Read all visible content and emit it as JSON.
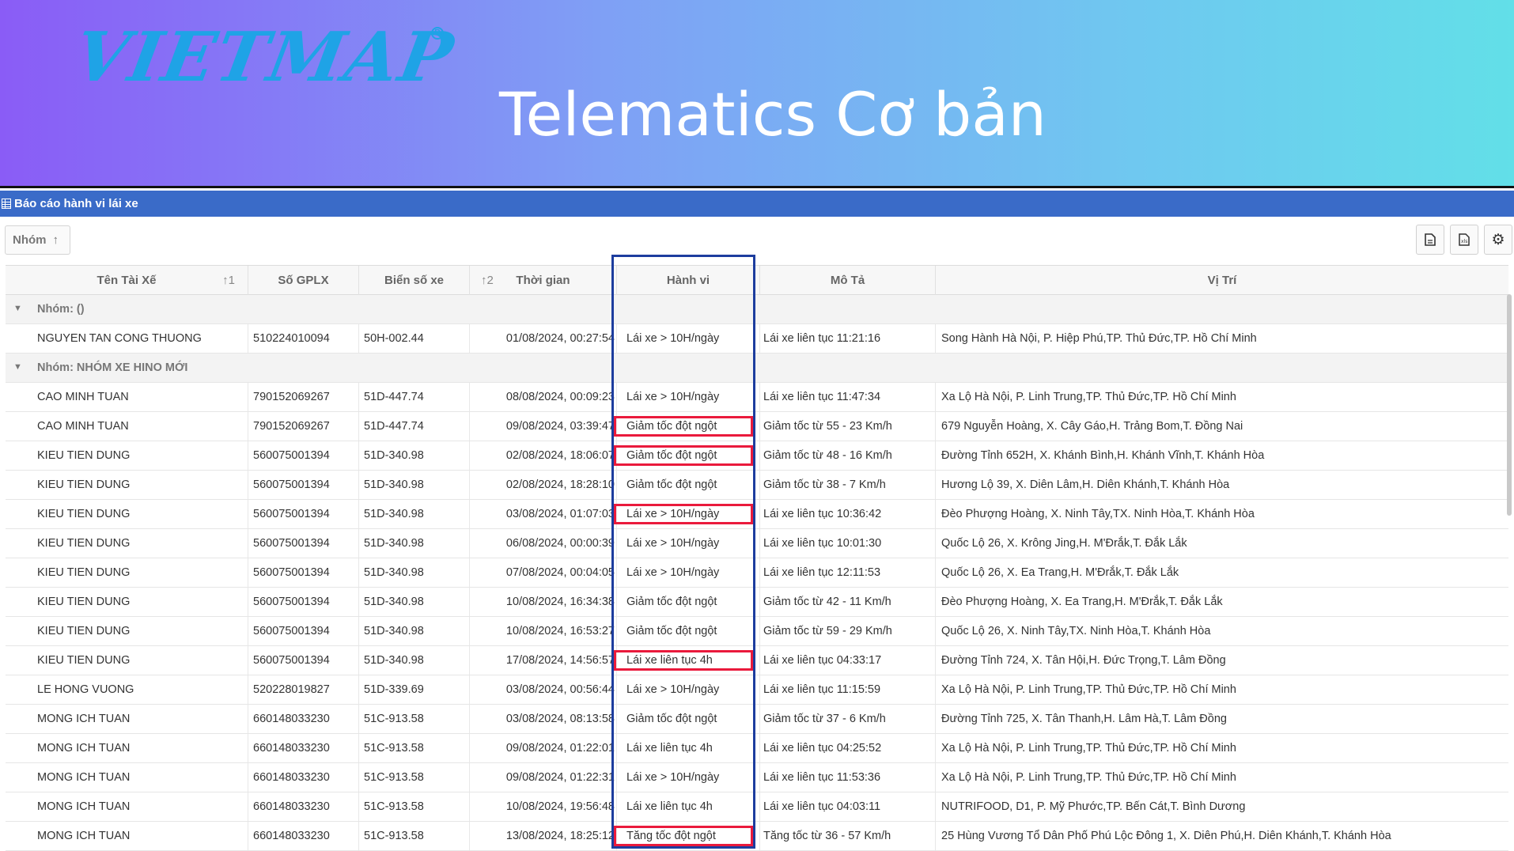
{
  "banner": {
    "logo": "VIETMAP",
    "title": "Telematics Cơ bản"
  },
  "window": {
    "title": "Báo cáo hành vi lái xe"
  },
  "toolbar": {
    "group_chip": "Nhóm",
    "buttons": [
      "file-icon",
      "export-icon",
      "gear-icon"
    ]
  },
  "columns": [
    {
      "label": "Tên Tài Xế",
      "sort": "↑1"
    },
    {
      "label": "Số GPLX",
      "sort": ""
    },
    {
      "label": "Biển số xe",
      "sort": ""
    },
    {
      "label": "Thời gian",
      "sort": "↑2"
    },
    {
      "label": "Hành vi",
      "sort": ""
    },
    {
      "label": "Mô Tả",
      "sort": ""
    },
    {
      "label": "Vị Trí",
      "sort": ""
    }
  ],
  "rows": [
    {
      "type": "group",
      "label": "Nhóm: ()"
    },
    {
      "type": "data",
      "cells": [
        "NGUYEN TAN CONG THUONG",
        "510224010094",
        "50H-002.44",
        "01/08/2024, 00:27:54",
        "Lái xe > 10H/ngày",
        "Lái xe liên tục 11:21:16",
        "Song Hành Hà Nội, P. Hiệp Phú,TP. Thủ Đức,TP. Hồ Chí Minh"
      ]
    },
    {
      "type": "group",
      "label": "Nhóm: NHÓM XE HINO MỚI"
    },
    {
      "type": "data",
      "cells": [
        "CAO MINH TUAN",
        "790152069267",
        "51D-447.74",
        "08/08/2024, 00:09:23",
        "Lái xe > 10H/ngày",
        "Lái xe liên tục 11:47:34",
        "Xa Lộ Hà Nội, P. Linh Trung,TP. Thủ Đức,TP. Hồ Chí Minh"
      ]
    },
    {
      "type": "data",
      "highlight": true,
      "cells": [
        "CAO MINH TUAN",
        "790152069267",
        "51D-447.74",
        "09/08/2024, 03:39:47",
        "Giảm tốc đột ngột",
        "Giảm tốc từ 55 - 23 Km/h",
        "679 Nguyễn Hoàng, X. Cây Gáo,H. Trảng Bom,T. Đồng Nai"
      ]
    },
    {
      "type": "data",
      "highlight": true,
      "cells": [
        "KIEU TIEN DUNG",
        "560075001394",
        "51D-340.98",
        "02/08/2024, 18:06:07",
        "Giảm tốc đột ngột",
        "Giảm tốc từ 48 - 16 Km/h",
        "Đường Tỉnh 652H, X. Khánh Bình,H. Khánh Vĩnh,T. Khánh Hòa"
      ]
    },
    {
      "type": "data",
      "cells": [
        "KIEU TIEN DUNG",
        "560075001394",
        "51D-340.98",
        "02/08/2024, 18:28:10",
        "Giảm tốc đột ngột",
        "Giảm tốc từ 38 - 7 Km/h",
        "Hương Lộ 39, X. Diên Lâm,H. Diên Khánh,T. Khánh Hòa"
      ]
    },
    {
      "type": "data",
      "highlight": true,
      "cells": [
        "KIEU TIEN DUNG",
        "560075001394",
        "51D-340.98",
        "03/08/2024, 01:07:03",
        "Lái xe > 10H/ngày",
        "Lái xe liên tục 10:36:42",
        "Đèo Phượng Hoàng, X. Ninh Tây,TX. Ninh Hòa,T. Khánh Hòa"
      ]
    },
    {
      "type": "data",
      "cells": [
        "KIEU TIEN DUNG",
        "560075001394",
        "51D-340.98",
        "06/08/2024, 00:00:39",
        "Lái xe > 10H/ngày",
        "Lái xe liên tục 10:01:30",
        "Quốc Lộ 26, X. Krông Jing,H. M'Đrắk,T. Đắk Lắk"
      ]
    },
    {
      "type": "data",
      "cells": [
        "KIEU TIEN DUNG",
        "560075001394",
        "51D-340.98",
        "07/08/2024, 00:04:05",
        "Lái xe > 10H/ngày",
        "Lái xe liên tục 12:11:53",
        "Quốc Lộ 26, X. Ea Trang,H. M'Đrắk,T. Đắk Lắk"
      ]
    },
    {
      "type": "data",
      "cells": [
        "KIEU TIEN DUNG",
        "560075001394",
        "51D-340.98",
        "10/08/2024, 16:34:38",
        "Giảm tốc đột ngột",
        "Giảm tốc từ 42 - 11 Km/h",
        "Đèo Phượng Hoàng, X. Ea Trang,H. M'Đrắk,T. Đắk Lắk"
      ]
    },
    {
      "type": "data",
      "cells": [
        "KIEU TIEN DUNG",
        "560075001394",
        "51D-340.98",
        "10/08/2024, 16:53:27",
        "Giảm tốc đột ngột",
        "Giảm tốc từ 59 - 29 Km/h",
        "Quốc Lộ 26, X. Ninh Tây,TX. Ninh Hòa,T. Khánh Hòa"
      ]
    },
    {
      "type": "data",
      "highlight": true,
      "cells": [
        "KIEU TIEN DUNG",
        "560075001394",
        "51D-340.98",
        "17/08/2024, 14:56:57",
        "Lái xe liên tục 4h",
        "Lái xe liên tục 04:33:17",
        "Đường Tỉnh 724, X. Tân Hội,H. Đức Trọng,T. Lâm Đồng"
      ]
    },
    {
      "type": "data",
      "cells": [
        "LE HONG VUONG",
        "520228019827",
        "51D-339.69",
        "03/08/2024, 00:56:44",
        "Lái xe > 10H/ngày",
        "Lái xe liên tục 11:15:59",
        "Xa Lộ Hà Nội, P. Linh Trung,TP. Thủ Đức,TP. Hồ Chí Minh"
      ]
    },
    {
      "type": "data",
      "cells": [
        "MONG ICH TUAN",
        "660148033230",
        "51C-913.58",
        "03/08/2024, 08:13:58",
        "Giảm tốc đột ngột",
        "Giảm tốc từ 37 - 6 Km/h",
        "Đường Tỉnh 725, X. Tân Thanh,H. Lâm Hà,T. Lâm Đồng"
      ]
    },
    {
      "type": "data",
      "cells": [
        "MONG ICH TUAN",
        "660148033230",
        "51C-913.58",
        "09/08/2024, 01:22:01",
        "Lái xe liên tục 4h",
        "Lái xe liên tục 04:25:52",
        "Xa Lộ Hà Nội, P. Linh Trung,TP. Thủ Đức,TP. Hồ Chí Minh"
      ]
    },
    {
      "type": "data",
      "cells": [
        "MONG ICH TUAN",
        "660148033230",
        "51C-913.58",
        "09/08/2024, 01:22:31",
        "Lái xe > 10H/ngày",
        "Lái xe liên tục 11:53:36",
        "Xa Lộ Hà Nội, P. Linh Trung,TP. Thủ Đức,TP. Hồ Chí Minh"
      ]
    },
    {
      "type": "data",
      "cells": [
        "MONG ICH TUAN",
        "660148033230",
        "51C-913.58",
        "10/08/2024, 19:56:48",
        "Lái xe liên tục 4h",
        "Lái xe liên tục 04:03:11",
        "NUTRIFOOD, D1, P. Mỹ Phước,TP. Bến Cát,T. Bình Dương"
      ]
    },
    {
      "type": "data",
      "highlight": true,
      "cells": [
        "MONG ICH TUAN",
        "660148033230",
        "51C-913.58",
        "13/08/2024, 18:25:12",
        "Tăng tốc đột ngột",
        "Tăng tốc từ 36 - 57 Km/h",
        "25 Hùng Vương Tổ Dân Phố Phú Lộc Đông 1, X. Diên Phú,H. Diên Khánh,T. Khánh Hòa"
      ]
    }
  ],
  "colors": {
    "header_bar": "#3a6bc8",
    "column_highlight": "#1d3d9e",
    "row_highlight": "#ea1a3c"
  }
}
